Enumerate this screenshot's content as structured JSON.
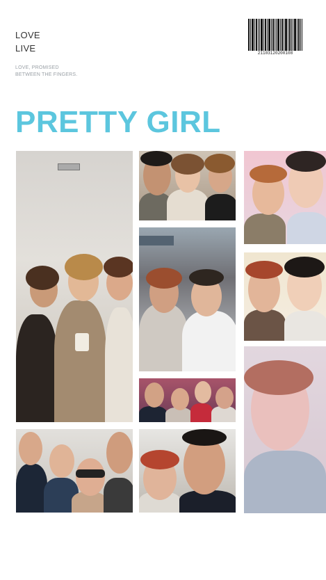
{
  "header": {
    "line1": "LOVE",
    "line2": "LIVE",
    "tagline_1": "LOVE, PROMISED",
    "tagline_2": "BETWEEN THE FINGERS."
  },
  "title": "PRETTY GIRL",
  "barcode": {
    "number": "21103120200108"
  },
  "colors": {
    "title": "#5cc6de",
    "text": "#333333",
    "tagline": "#9aa0a6"
  },
  "photos": [
    {
      "id": "group-trio"
    },
    {
      "id": "selfie-three"
    },
    {
      "id": "two-women-pink"
    },
    {
      "id": "event-hall-pair"
    },
    {
      "id": "two-women-thumbs"
    },
    {
      "id": "small-group"
    },
    {
      "id": "woman-portrait"
    },
    {
      "id": "group-sunglasses"
    },
    {
      "id": "glasses-pair"
    }
  ]
}
